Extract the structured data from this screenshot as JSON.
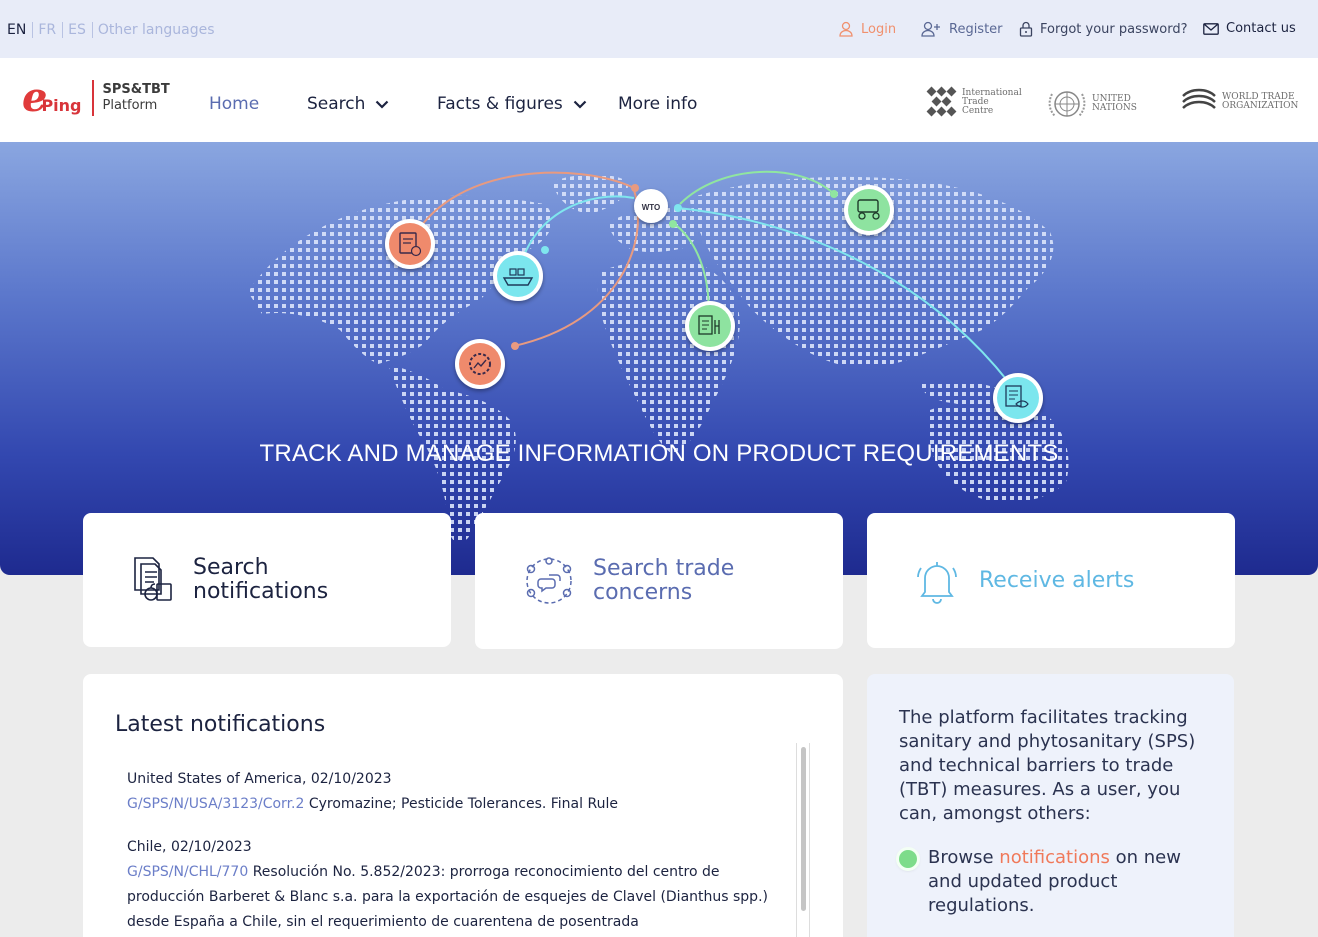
{
  "languages": [
    {
      "code": "EN",
      "active": true
    },
    {
      "code": "FR",
      "active": false
    },
    {
      "code": "ES",
      "active": false
    },
    {
      "code": "Other languages",
      "active": false
    }
  ],
  "utility": {
    "login": "Login",
    "register": "Register",
    "forgot": "Forgot your password?",
    "contact": "Contact us"
  },
  "logo": {
    "letter": "e",
    "name": "Ping",
    "line1": "SPS&TBT",
    "line2": "Platform"
  },
  "nav": {
    "home": "Home",
    "search": "Search",
    "facts": "Facts & figures",
    "more": "More info"
  },
  "partners": {
    "itc": [
      "International",
      "Trade",
      "Centre"
    ],
    "un": [
      "UNITED",
      "NATIONS"
    ],
    "wto": [
      "World Trade",
      "Organization"
    ]
  },
  "hero": {
    "hub_label": "WTO",
    "title": "TRACK AND MANAGE INFORMATION ON PRODUCT REQUIREMENTS"
  },
  "cards": {
    "search_notifications": [
      "Search",
      "notifications"
    ],
    "search_concerns": [
      "Search trade",
      "concerns"
    ],
    "receive_alerts": "Receive alerts"
  },
  "latest": {
    "title": "Latest notifications",
    "items": [
      {
        "header": "United States of America, 02/10/2023",
        "code": "G/SPS/N/USA/3123/Corr.2",
        "text": "Cyromazine; Pesticide Tolerances. Final Rule"
      },
      {
        "header": "Chile, 02/10/2023",
        "code": "G/SPS/N/CHL/770",
        "text": "Resolución No. 5.852/2023: prorroga reconocimiento del centro de producción Barberet & Blanc s.a. para la exportación de esquejes de Clavel (Dianthus spp.) desde España a Chile, sin el requerimiento de cuarentena de posentrada"
      }
    ]
  },
  "info": {
    "intro": "The platform facilitates tracking sanitary and phytosanitary (SPS) and technical barriers to trade (TBT) measures. As a user, you can, amongst others:",
    "bullet_pre": "Browse",
    "bullet_link": "notifications",
    "bullet_post": "on new and updated product regulations."
  },
  "colors": {
    "accent": "#5a6cb0",
    "login": "#f0906e",
    "alerts": "#5fb8e3",
    "brand_red": "#d8343a",
    "green_node": "#8ee3a0",
    "cyan_node": "#7be6ee",
    "orange_node": "#ef8a6c"
  },
  "icons": {
    "login": "user-icon",
    "register": "user-plus-icon",
    "forgot": "lock-icon",
    "contact": "envelope-icon",
    "card1": "documents-icon",
    "card2": "discussion-circle-icon",
    "card3": "bell-icon"
  }
}
